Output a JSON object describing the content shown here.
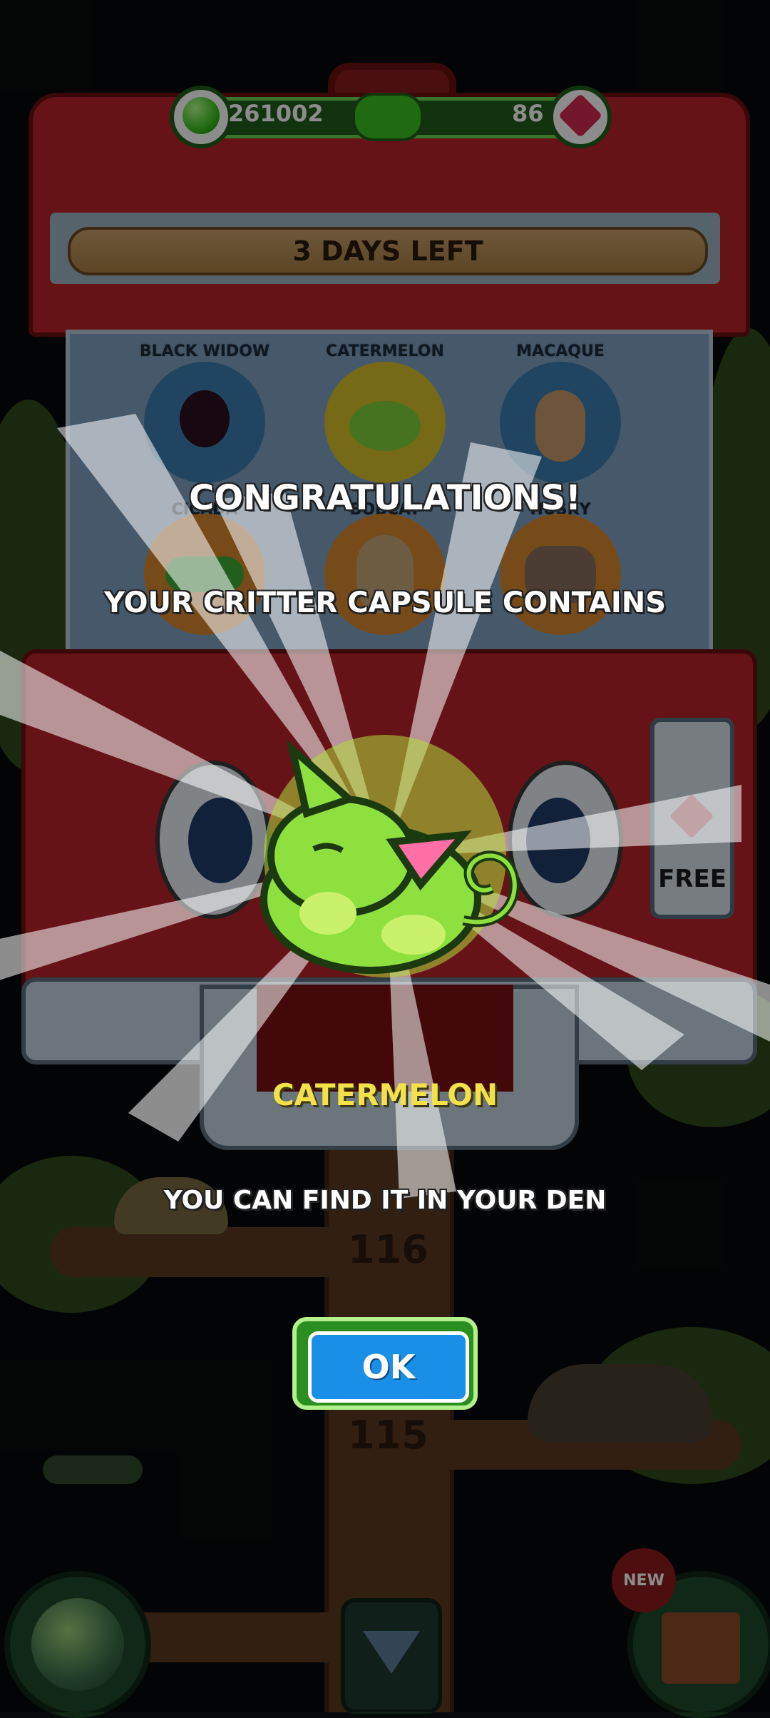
{
  "hud": {
    "coins": "261002",
    "gems": "86",
    "coin_icon": "green-gem-icon",
    "gem_icon": "red-crystal-icon"
  },
  "machine": {
    "timer_text": "3 DAYS LEFT",
    "free_label": "FREE",
    "critters": [
      {
        "name": "BLACK WIDOW",
        "color": "#3d7fb0"
      },
      {
        "name": "CATERMELON",
        "color": "#d8c12a"
      },
      {
        "name": "MACAQUE",
        "color": "#3d7fb0"
      },
      {
        "name": "CICADA",
        "color": "#d9892f"
      },
      {
        "name": "BOBCAT",
        "color": "#d9892f"
      },
      {
        "name": "HUSKY",
        "color": "#d9892f"
      }
    ]
  },
  "background": {
    "floor_numbers": [
      "116",
      "115"
    ],
    "new_badge": "NEW"
  },
  "reward": {
    "title": "CONGRATULATIONS!",
    "subtitle": "YOUR CRITTER CAPSULE CONTAINS",
    "critter_name": "CATERMELON",
    "message": "YOU CAN FIND IT IN YOUR DEN",
    "ok_label": "OK"
  },
  "colors": {
    "machine_red": "#b8242a",
    "hud_green": "#1f5e1a",
    "ok_blue": "#1a8fe8",
    "name_yellow": "#f4e14a"
  }
}
